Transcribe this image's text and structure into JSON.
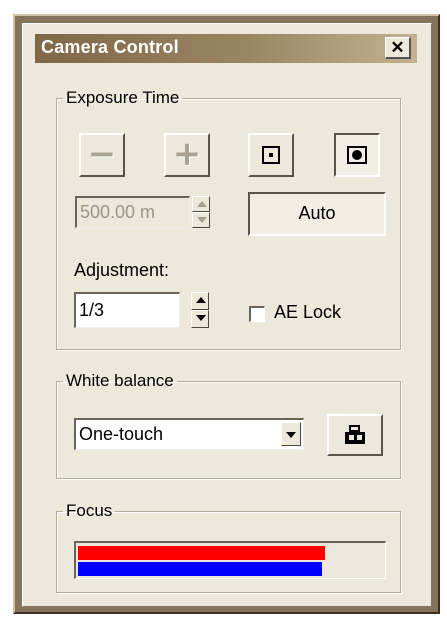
{
  "window": {
    "title": "Camera Control",
    "close_label": "✕"
  },
  "exposure": {
    "group_label": "Exposure Time",
    "minus_glyph": "−",
    "plus_glyph": "+",
    "value": "500.00 m",
    "auto_label": "Auto",
    "adjustment_label": "Adjustment:",
    "adjustment_value": "1/3",
    "ae_lock_label": "AE Lock",
    "ae_lock_checked": false
  },
  "white_balance": {
    "group_label": "White balance",
    "selected": "One-touch",
    "onetouch_icon": "camera-icon"
  },
  "focus": {
    "group_label": "Focus",
    "bars": [
      {
        "name": "red",
        "color": "#ff0000",
        "level": 0.81
      },
      {
        "name": "blue",
        "color": "#0000ff",
        "level": 0.8
      }
    ]
  },
  "colors": {
    "titlebar_start": "#7f6748",
    "titlebar_end": "#c3b18f",
    "panel": "#ede8dc",
    "frame": "#85735a"
  }
}
